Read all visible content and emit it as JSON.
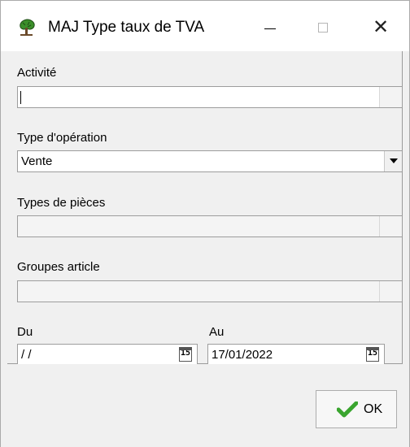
{
  "window": {
    "title": "MAJ Type taux de TVA"
  },
  "fields": {
    "activite": {
      "label": "Activité",
      "value": ""
    },
    "type_operation": {
      "label": "Type d'opération",
      "value": "Vente"
    },
    "types_pieces": {
      "label": "Types de pièces",
      "value": ""
    },
    "groupes_article": {
      "label": "Groupes article",
      "value": ""
    }
  },
  "dates": {
    "du": {
      "label": "Du",
      "value": " / /"
    },
    "au": {
      "label": "Au",
      "value": "17/01/2022"
    },
    "calendar_icon_text": "15"
  },
  "footer": {
    "ok_label": "OK"
  },
  "colors": {
    "check_green": "#3aa52f",
    "title_bg": "#ffffff",
    "body_bg": "#f0f0f0"
  }
}
